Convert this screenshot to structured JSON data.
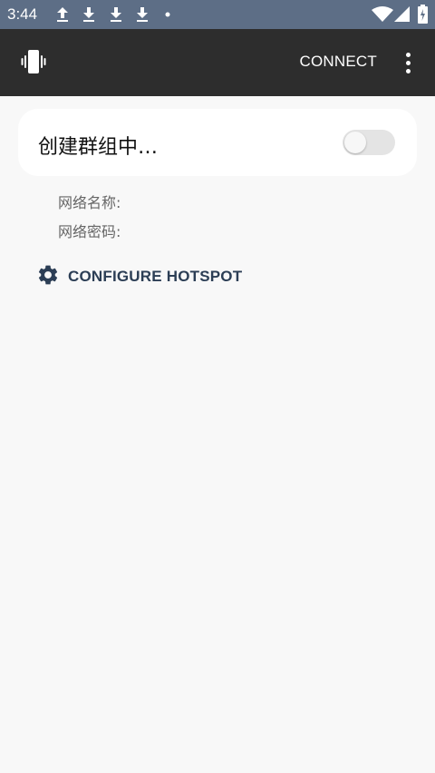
{
  "status_bar": {
    "time": "3:44",
    "icons": [
      "upload-icon",
      "download-icon",
      "download-icon",
      "download-icon",
      "notification-dot-icon",
      "wifi-icon",
      "signal-icon",
      "battery-charging-icon"
    ]
  },
  "app_bar": {
    "logo_icon": "phone-vibrate-icon",
    "connect_label": "CONNECT",
    "overflow_icon": "more-vert-icon"
  },
  "group_card": {
    "title": "创建群组中…",
    "toggle_on": false
  },
  "network_info": {
    "name_label": "网络名称:",
    "password_label": "网络密码:"
  },
  "configure": {
    "icon": "gear-icon",
    "label": "CONFIGURE HOTSPOT"
  },
  "colors": {
    "status_bar": "#5d6e86",
    "app_bar": "#2d2d2d",
    "background": "#f8f8f8",
    "accent": "#2c3e55"
  }
}
